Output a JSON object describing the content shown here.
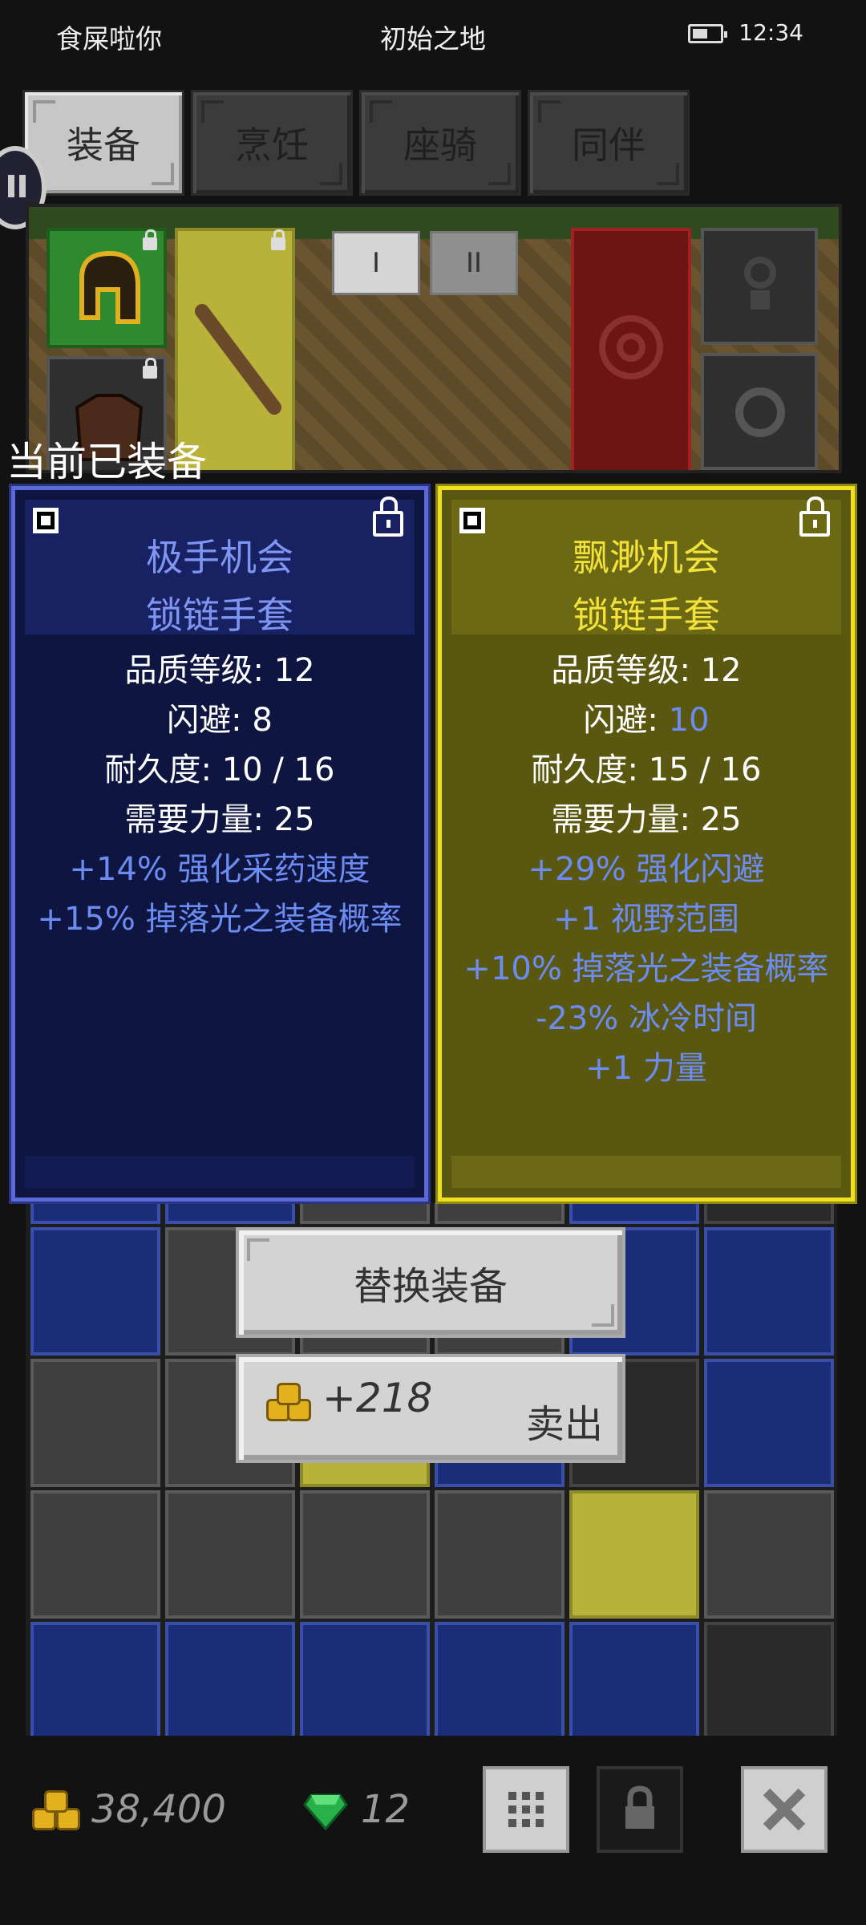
{
  "status_bar": {
    "left_text": "食屎啦你",
    "center_text": "初始之地",
    "time": "12:34"
  },
  "tabs": [
    {
      "label": "装备",
      "active": true
    },
    {
      "label": "烹饪",
      "active": false
    },
    {
      "label": "座骑",
      "active": false
    },
    {
      "label": "同伴",
      "active": false
    }
  ],
  "loadout_tabs": [
    "I",
    "II"
  ],
  "equipped_heading": "当前已装备",
  "equipped_item": {
    "name_line1": "极手机会",
    "name_line2": "锁链手套",
    "rarity_color": "#7f95f2",
    "stats": [
      "品质等级: 12",
      "闪避: 8",
      "耐久度: 10 / 16",
      "需要力量: 25"
    ],
    "affixes": [
      "+14% 强化采药速度",
      "+15% 掉落光之装备概率"
    ]
  },
  "new_item": {
    "name_line1": "飘渺机会",
    "name_line2": "锁链手套",
    "rarity_color": "#f3e23a",
    "quality": "品质等级: 12",
    "dodge_label": "闪避: ",
    "dodge_value": "10",
    "durability": "耐久度: 15 / 16",
    "strength_req": "需要力量: 25",
    "affixes": [
      "+29% 强化闪避",
      "+1 视野范围",
      "+10% 掉落光之装备概率",
      "-23% 冰冷时间",
      "+1 力量"
    ]
  },
  "actions": {
    "replace_label": "替换装备",
    "sell_price": "+218",
    "sell_label": "卖出"
  },
  "currency": {
    "gold": "38,400",
    "gems": "12"
  },
  "icons": {
    "gold": "coin-stack-icon",
    "gem": "emerald-icon",
    "grid": "grid-icon",
    "lock": "lock-icon",
    "close": "close-icon"
  }
}
